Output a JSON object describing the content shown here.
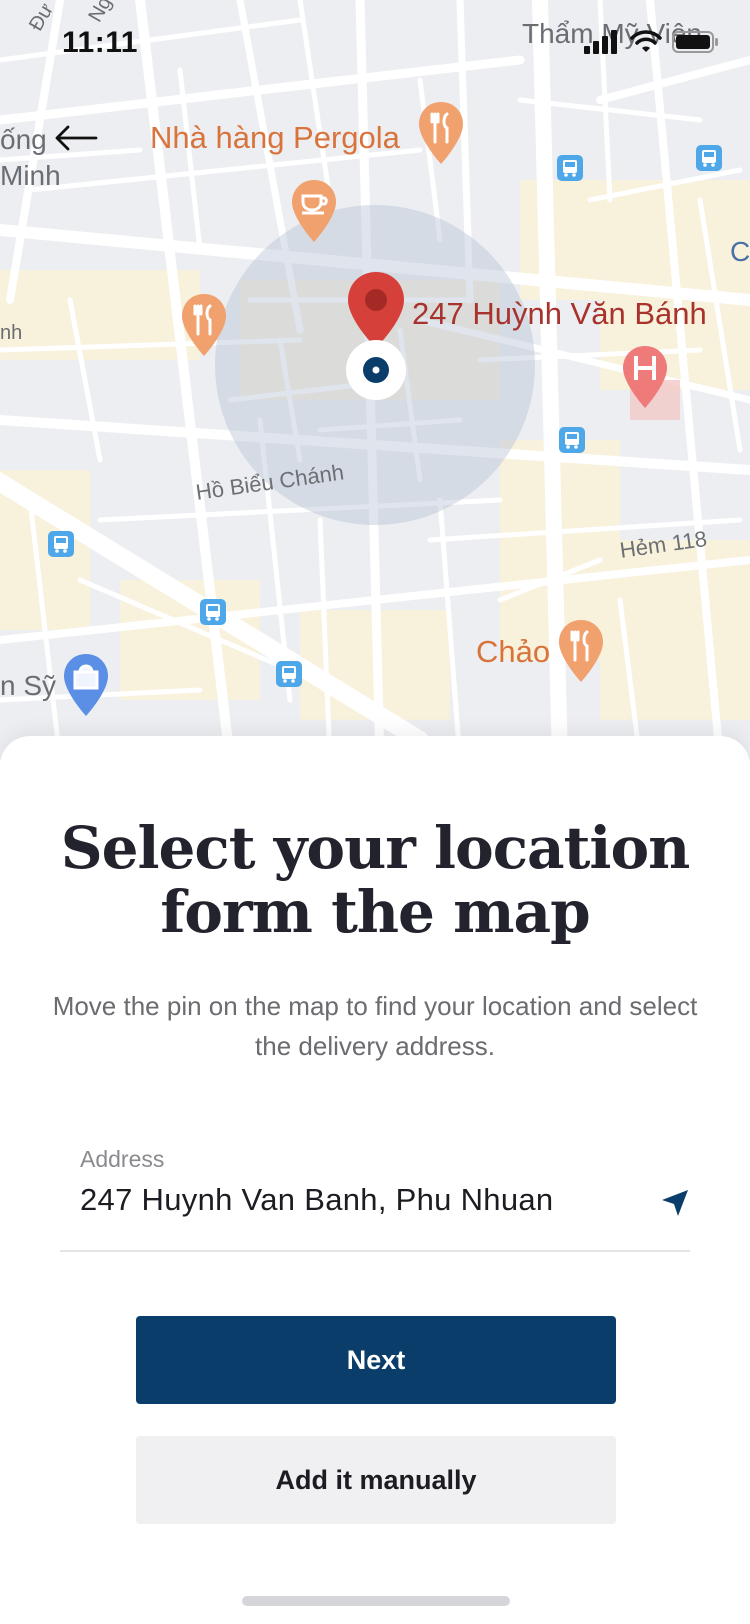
{
  "status_bar": {
    "time": "11:11"
  },
  "map": {
    "labels": {
      "place_top_right": "Thẩm Mỹ Viện",
      "restaurant_pergola": "Nhà hàng Pergola",
      "selected_address": "247 Huỳnh Văn Bánh",
      "street_ho_bieu_chanh": "Hồ Biểu Chánh",
      "alley_118": "Hẻm 118",
      "restaurant_chao": "Chảo",
      "edge_left_1": "ống",
      "edge_left_2": "Minh",
      "edge_left_3": "nh",
      "edge_left_4": "n Sỹ",
      "edge_right_1": "C",
      "edge_top_1": "Đư",
      "edge_top_2": "Ng"
    },
    "colors": {
      "pin": "#d6403a",
      "pin_dot": "#0b3d6b",
      "poi": "#f0a16d",
      "hospital": "#ee7a7a",
      "bus": "#4ea7e8",
      "shop": "#5b8fe6"
    }
  },
  "sheet": {
    "title_line1": "Select your location",
    "title_line2": "form the map",
    "subtitle": "Move the pin on the map to find your location and select the delivery address.",
    "address_label": "Address",
    "address_value": "247 Huynh Van Banh, Phu Nhuan",
    "next_label": "Next",
    "manual_label": "Add it manually"
  },
  "colors": {
    "primary": "#0b3d6b",
    "title": "#23232e",
    "secondary_bg": "#f0f0f2"
  }
}
